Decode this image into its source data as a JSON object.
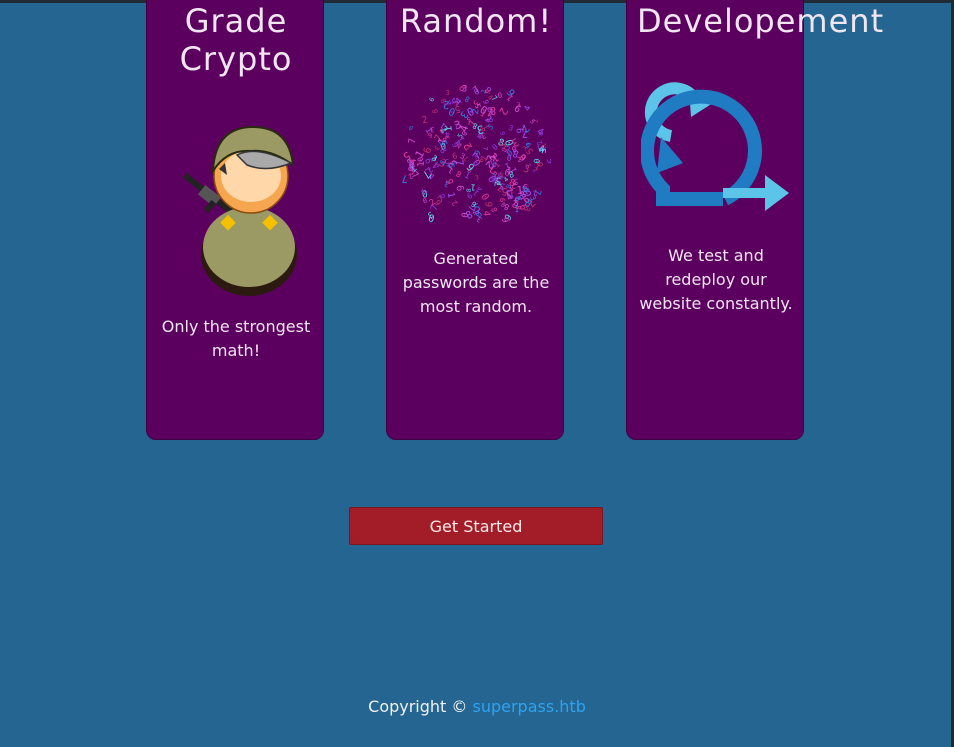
{
  "features": [
    {
      "title_lines": [
        "Grade",
        "Crypto"
      ],
      "description": "Only the strongest math!",
      "image": "soldier-icon"
    },
    {
      "title_lines": [
        "Random!"
      ],
      "description": "Generated passwords are the most random.",
      "image": "random-digits-sphere-icon"
    },
    {
      "title_lines": [
        "Developement"
      ],
      "description": "We test and redeploy our website constantly.",
      "image": "agile-cycle-icon"
    }
  ],
  "cta": {
    "label": "Get Started"
  },
  "footer": {
    "copyright_text": "Copyright ©",
    "link_text": "superpass.htb"
  },
  "colors": {
    "page_background": "#246591",
    "card_background": "#5c0060",
    "button_background": "#a31d28",
    "link": "#2fa3f0"
  }
}
